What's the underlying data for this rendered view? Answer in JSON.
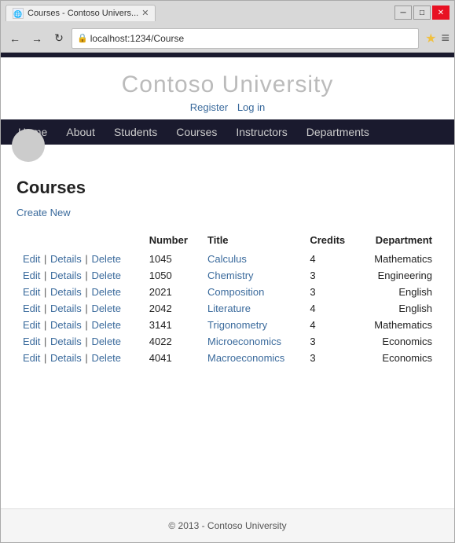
{
  "browser": {
    "tab_title": "Courses - Contoso Univers...",
    "url": "localhost:1234/Course",
    "min_label": "─",
    "max_label": "□",
    "close_label": "✕"
  },
  "site": {
    "title": "Contoso University",
    "auth": {
      "register": "Register",
      "login": "Log in"
    },
    "nav": [
      "Home",
      "About",
      "Students",
      "Courses",
      "Instructors",
      "Departments"
    ]
  },
  "page": {
    "heading": "Courses",
    "create_new": "Create New",
    "table": {
      "headers": [
        "",
        "Number",
        "Title",
        "Credits",
        "Department"
      ],
      "rows": [
        {
          "number": "1045",
          "title": "Calculus",
          "credits": "4",
          "department": "Mathematics"
        },
        {
          "number": "1050",
          "title": "Chemistry",
          "credits": "3",
          "department": "Engineering"
        },
        {
          "number": "2021",
          "title": "Composition",
          "credits": "3",
          "department": "English"
        },
        {
          "number": "2042",
          "title": "Literature",
          "credits": "4",
          "department": "English"
        },
        {
          "number": "3141",
          "title": "Trigonometry",
          "credits": "4",
          "department": "Mathematics"
        },
        {
          "number": "4022",
          "title": "Microeconomics",
          "credits": "3",
          "department": "Economics"
        },
        {
          "number": "4041",
          "title": "Macroeconomics",
          "credits": "3",
          "department": "Economics"
        }
      ],
      "actions": [
        "Edit",
        "Details",
        "Delete"
      ]
    }
  },
  "footer": {
    "text": "© 2013 - Contoso University"
  }
}
